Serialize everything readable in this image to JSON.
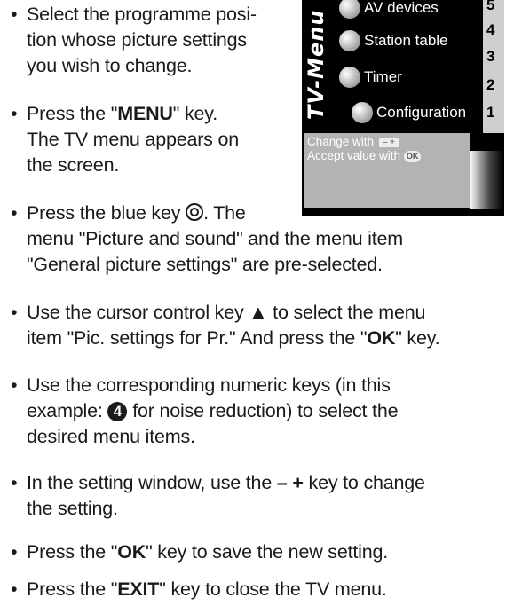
{
  "steps": {
    "s1": {
      "l1": "Select the programme posi-",
      "l2": "tion whose picture settings",
      "l3": "you wish to change."
    },
    "s2": {
      "pre": "Press the \"",
      "key": "MENU",
      "post": "\" key.",
      "l2": "The TV menu appears on",
      "l3": "the screen."
    },
    "s3": {
      "l1": "Press the blue key",
      "l1b": ". The",
      "l2": "menu \"Picture and sound\" and the menu item",
      "l3": "\"General picture settings\" are pre-selected."
    },
    "s4": {
      "l1": "Use the cursor control key ▲ to select the menu",
      "l2pre": "item \"Pic. settings for Pr.\" And press the \"",
      "key": "OK",
      "l2post": "\" key."
    },
    "s5": {
      "l1": "Use the corresponding numeric keys (in this",
      "l2pre": "example: ",
      "num": "4",
      "l2post": " for noise reduction) to select the",
      "l3": "desired menu items."
    },
    "s6": {
      "pre": "In the setting window, use the ",
      "key": "– +",
      "post": " key to change",
      "l2": "the setting."
    },
    "s7": {
      "pre": "Press the \"",
      "key": "OK",
      "post": "\" key to save the new setting."
    },
    "s8": {
      "pre": "Press the \"",
      "key": "EXIT",
      "post": "\" key to close the TV menu."
    }
  },
  "tv_menu": {
    "side_label": "TV-Menu",
    "items": [
      "AV devices",
      "Station table",
      "Timer",
      "Configuration"
    ],
    "numbers": [
      "5",
      "4",
      "3",
      "2",
      "1"
    ],
    "hint_change": "Change with",
    "hint_minus_plus": "–  +",
    "hint_accept": "Accept value with",
    "hint_ok": "OK"
  }
}
